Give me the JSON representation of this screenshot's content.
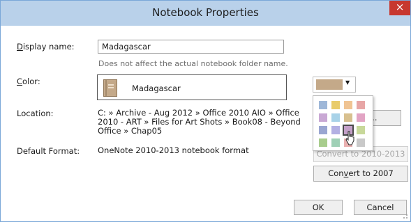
{
  "window": {
    "title": "Notebook Properties",
    "close_glyph": "×"
  },
  "fields": {
    "display_name_label_pre": "",
    "display_name_label_ul": "D",
    "display_name_label_post": "isplay name:",
    "display_name_value": "Madagascar",
    "display_name_hint": "Does not affect the actual notebook folder name.",
    "color_label_ul": "C",
    "color_label_post": "olor:",
    "color_notebook_name": "Madagascar",
    "location_label": "Location:",
    "location_line1": "C: » Archive - Aug 2012 » Office 2010 AIO » Office",
    "location_line2": "2010 - ART » Files for Art Shots » Book08 - Beyond",
    "location_line3": "Office » Chap05",
    "default_format_label": "Default Format:",
    "default_format_value": "OneNote 2010-2013 notebook format"
  },
  "color_picker": {
    "selected_color": "#c4a989",
    "swatches": [
      [
        "#9eb7d8",
        "#e9cc6b",
        "#f0c493",
        "#e7a6a6"
      ],
      [
        "#c9a8d4",
        "#a8d2e8",
        "#d8c08f",
        "#e2a4c4"
      ],
      [
        "#9aa6d1",
        "#b3b0e3",
        "#c4a0c8",
        "#c8d89a"
      ],
      [
        "#a8cd8d",
        "#9fd0b6",
        "#eab1b1",
        "#c9c9c9"
      ]
    ],
    "selected_row": 2,
    "selected_col": 2
  },
  "buttons": {
    "change_location_partial": "ion...",
    "convert_2010": "Convert to 2010-2013",
    "convert_2007_pre": "Con",
    "convert_2007_ul": "v",
    "convert_2007_post": "ert to 2007",
    "ok": "OK",
    "cancel": "Cancel"
  }
}
